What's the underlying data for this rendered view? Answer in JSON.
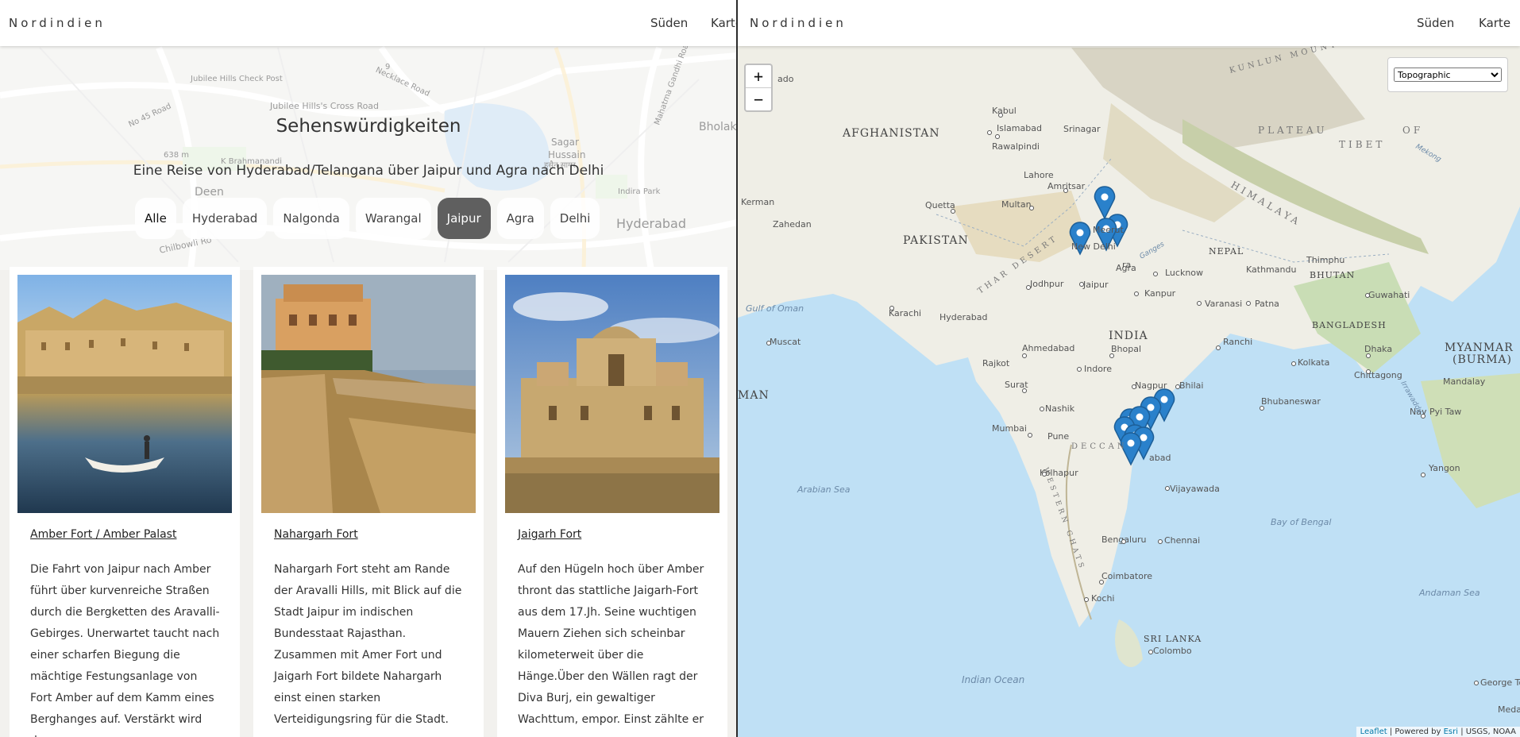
{
  "left_page": {
    "brand": "Nordindien",
    "nav": {
      "south": "Süden",
      "map": "Karte"
    },
    "title": "Sehenswürdigkeiten",
    "subtitle": "Eine Reise von Hyderabad/Telangana über Jaipur und Agra nach Delhi",
    "filters": [
      "Alle",
      "Hyderabad",
      "Nalgonda",
      "Warangal",
      "Jaipur",
      "Agra",
      "Delhi"
    ],
    "active_filter": "Jaipur",
    "background_map_labels": [
      "Jubilee Hills Check Post",
      "Jubilee Hills's Cross Road",
      "No 45 Road",
      "Deen",
      "Necklace Road",
      "Hussain",
      "Sagar",
      "हुसैन सागर",
      "Bholak",
      "Indira Park",
      "Hyderabad",
      "K Brahmanandi",
      "Mahatma Gandhi Road",
      "638 m",
      "Chilbowli Ro",
      "9"
    ],
    "cards": [
      {
        "title": "Amber Fort / Amber Palast",
        "text": "Die Fahrt von Jaipur nach Amber führt über kurvenreiche Straßen durch die Bergketten des Aravalli-Gebirges. Unerwartet taucht nach einer scharfen Biegung die mächtige Festungsanlage von Fort Amber auf dem Kamm eines Berghanges auf. Verstärkt wird der"
      },
      {
        "title": "Nahargarh Fort",
        "text": "Nahargarh Fort steht am Rande der Aravalli Hills, mit Blick auf die Stadt Jaipur im indischen Bundesstaat Rajasthan. Zusammen mit Amer Fort und Jaigarh Fort bildete Nahargarh einst einen starken Verteidigungsring für die Stadt."
      },
      {
        "title": "Jaigarh Fort",
        "text": "Auf den Hügeln hoch über Amber thront das stattliche Jaigarh-Fort aus dem 17.Jh. Seine wuchtigen Mauern Ziehen sich scheinbar kilometerweit über die Hänge.Über den Wällen ragt der Diva Burj, ein gewaltiger Wachttum, empor. Einst zählte er"
      }
    ]
  },
  "right_page": {
    "brand": "Nordindien",
    "nav": {
      "south": "Süden",
      "map": "Karte"
    },
    "zoom_in": "+",
    "zoom_out": "−",
    "layer_select": {
      "value": "Topographic",
      "options": [
        "Topographic"
      ]
    },
    "attribution": {
      "leaflet": "Leaflet",
      "powered": "| Powered by",
      "esri": "Esri",
      "sources": "| USGS, NOAA"
    },
    "map_labels": {
      "countries": [
        "AFGHANISTAN",
        "PAKISTAN",
        "INDIA",
        "NEPAL",
        "BHUTAN",
        "BANGLADESH",
        "MYANMAR",
        "(BURMA)",
        "SRI LANKA",
        "MAN"
      ],
      "regions": [
        "PLATEAU",
        "OF",
        "TIBET",
        "HIMALAYA",
        "THAR DESERT",
        "DECCAN",
        "WESTERN GHATS",
        "KUNLUN MOUNTAINS"
      ],
      "water": [
        "Gulf of Oman",
        "Arabian Sea",
        "Bay of Bengal",
        "Andaman Sea",
        "Indian Ocean"
      ],
      "cities": [
        "Kabul",
        "Islamabad",
        "Srinagar",
        "Rawalpindi",
        "Lahore",
        "Amritsar",
        "Quetta",
        "Multan",
        "Kerman",
        "Zahedan",
        "Karachi",
        "Hyderabad",
        "Jodhpur",
        "Jaipur",
        "New Delhi",
        "Meerut",
        "Agra",
        "Lucknow",
        "Kanpur",
        "Varanasi",
        "Patna",
        "Kathmandu",
        "Thimphu",
        "Guwahati",
        "Muscat",
        "Ahmedabad",
        "Bhopal",
        "Rajkot",
        "Indore",
        "Ranchi",
        "Kolkata",
        "Dhaka",
        "Chittagong",
        "Mandalay",
        "Surat",
        "Nagpur",
        "Bhilai",
        "Bhubaneswar",
        "Nay Pyi Taw",
        "Nashik",
        "Mumbai",
        "Pune",
        "Kolhapur",
        "Vijayawada",
        "Yangon",
        "Bengaluru",
        "Chennai",
        "Coimbatore",
        "Kochi",
        "Colombo",
        "George Town",
        "Medan",
        "abad",
        "ra",
        "ado",
        "Ganges",
        "Irrawaddy",
        "Mekong"
      ]
    }
  },
  "icons": [
    "map-marker-icon",
    "chevron-down-icon"
  ],
  "colors": {
    "active_filter": "#5f5f5f",
    "marker": "#2a81cb",
    "ocean": "#bfe0f5",
    "land": "#f0efe7",
    "link": "#0078a8"
  }
}
